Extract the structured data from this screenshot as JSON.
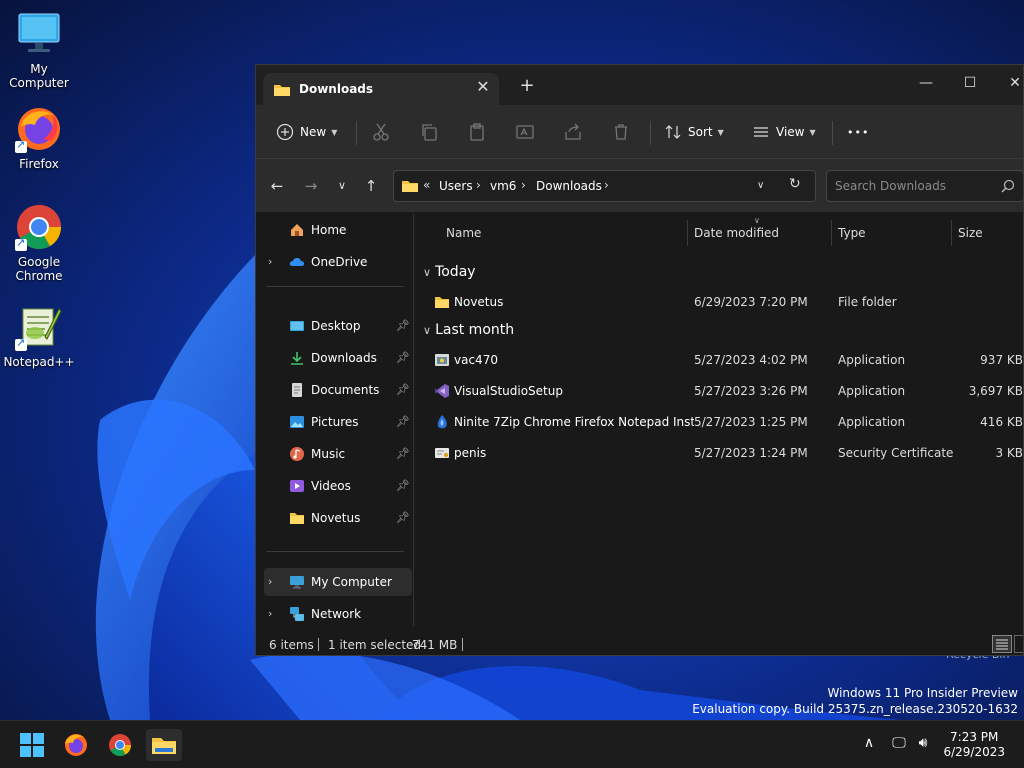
{
  "desktop": {
    "icons": [
      {
        "label": "My Computer",
        "icon": "monitor-icon"
      },
      {
        "label": "Firefox",
        "icon": "firefox-icon"
      },
      {
        "label": "Google Chrome",
        "icon": "chrome-icon"
      },
      {
        "label": "Notepad++",
        "icon": "notepadpp-icon"
      }
    ],
    "recycle_bin_partial": "Recycle Bin"
  },
  "window": {
    "tab_title": "Downloads",
    "toolbar": {
      "new_label": "New",
      "sort_label": "Sort",
      "view_label": "View",
      "more_label": "•••"
    },
    "address": {
      "overflow": "«",
      "crumbs": [
        "Users",
        "vm6",
        "Downloads"
      ]
    },
    "search_placeholder": "Search Downloads",
    "sidebar": {
      "home": "Home",
      "onedrive": "OneDrive",
      "pinned": [
        {
          "label": "Desktop",
          "icon": "desktop-icon"
        },
        {
          "label": "Downloads",
          "icon": "download-icon"
        },
        {
          "label": "Documents",
          "icon": "documents-icon"
        },
        {
          "label": "Pictures",
          "icon": "pictures-icon"
        },
        {
          "label": "Music",
          "icon": "music-icon"
        },
        {
          "label": "Videos",
          "icon": "videos-icon"
        },
        {
          "label": "Novetus",
          "icon": "folder-icon"
        }
      ],
      "my_computer": "My Computer",
      "network": "Network"
    },
    "columns": {
      "name": "Name",
      "date": "Date modified",
      "type": "Type",
      "size": "Size"
    },
    "groups": {
      "today": {
        "label": "Today",
        "rows": [
          {
            "name": "Novetus",
            "date": "6/29/2023 7:20 PM",
            "type": "File folder",
            "size": ""
          }
        ]
      },
      "last_month": {
        "label": "Last month",
        "rows": [
          {
            "name": "vac470",
            "date": "5/27/2023 4:02 PM",
            "type": "Application",
            "size": "937 KB"
          },
          {
            "name": "VisualStudioSetup",
            "date": "5/27/2023 3:26 PM",
            "type": "Application",
            "size": "3,697 KB"
          },
          {
            "name": "Ninite 7Zip Chrome Firefox Notepad Inst...",
            "date": "5/27/2023 1:25 PM",
            "type": "Application",
            "size": "416 KB"
          },
          {
            "name": "penis",
            "date": "5/27/2023 1:24 PM",
            "type": "Security Certificate",
            "size": "3 KB"
          }
        ]
      }
    },
    "status": {
      "items": "6 items",
      "selected": "1 item selected",
      "size": "741 MB"
    }
  },
  "watermark": {
    "line1": "Windows 11 Pro Insider Preview",
    "line2": "Evaluation copy. Build 25375.zn_release.230520-1632"
  },
  "taskbar": {
    "time": "7:23 PM",
    "date": "6/29/2023"
  },
  "colors": {
    "accent": "#60cdff",
    "folder": "#f5c342",
    "window_bg": "#191919",
    "toolbar_bg": "#2c2c2c"
  }
}
